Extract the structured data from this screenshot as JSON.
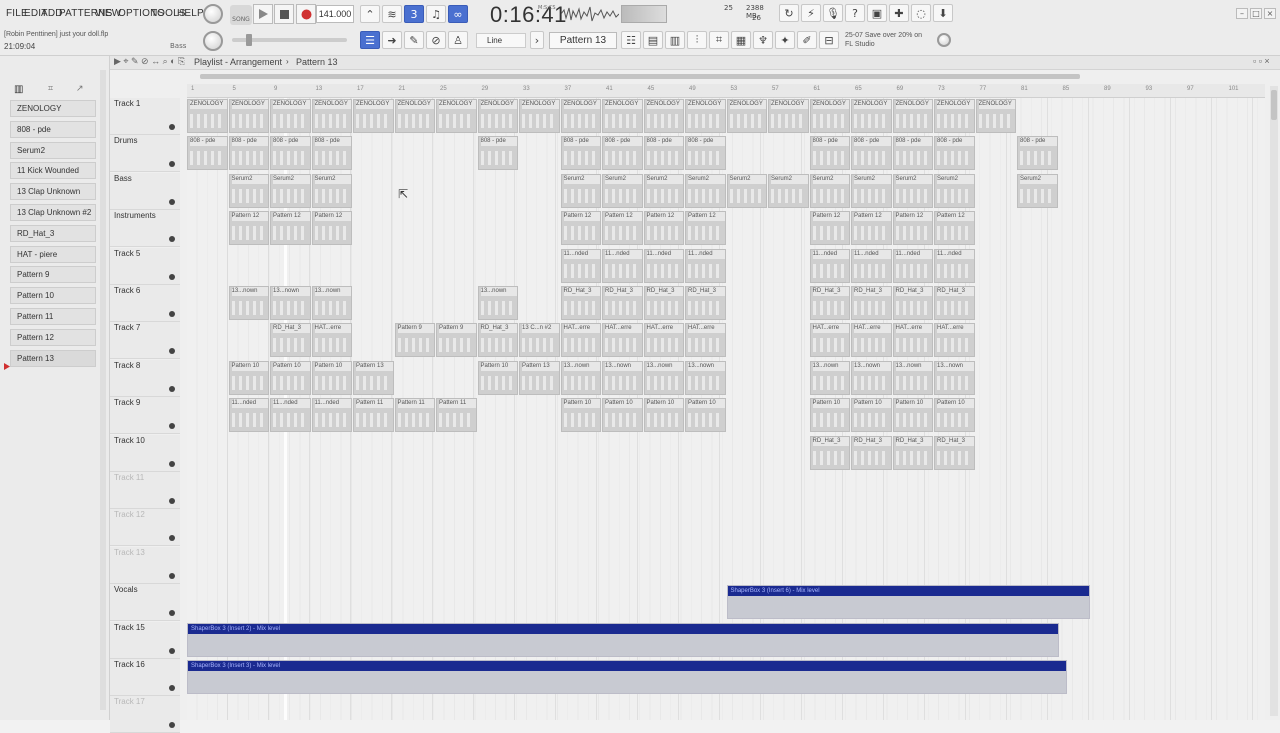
{
  "menu": [
    "FILE",
    "EDIT",
    "ADD",
    "PATTERNS",
    "VIEW",
    "OPTIONS",
    "TOOLS",
    "HELP"
  ],
  "hint_text": "[Robin Penttinen]  just your doll.flp",
  "hint_tag": "Bass",
  "clock": "21:09:04",
  "song_mode": "SONG",
  "tempo": "141.000",
  "time_display": "0:16:41",
  "time_units": "M:S:CS",
  "cpu": {
    "value": "25",
    "memory": "2388 MB",
    "polyphony": "26"
  },
  "pattern_selector": "Pattern 13",
  "snap": "Line",
  "news": {
    "line1": "25-07  Save over 20% on",
    "line2": "FL Studio"
  },
  "playlist": {
    "title": "Playlist - Arrangement",
    "pattern": "Pattern 13",
    "ruler": [
      "1",
      "5",
      "9",
      "13",
      "17",
      "21",
      "25",
      "29",
      "33",
      "37",
      "41",
      "45",
      "49",
      "53",
      "57",
      "61",
      "65",
      "69",
      "73",
      "77",
      "81",
      "85",
      "89",
      "93",
      "97",
      "101"
    ]
  },
  "channels": [
    {
      "label": "ZENOLOGY"
    },
    {
      "label": "808 - pde"
    },
    {
      "label": "Serum2"
    },
    {
      "label": "11 Kick Wounded"
    },
    {
      "label": "13 Clap Unknown"
    },
    {
      "label": "13 Clap Unknown #2"
    },
    {
      "label": "RD_Hat_3"
    },
    {
      "label": "HAT - piere"
    },
    {
      "label": "Pattern 9"
    },
    {
      "label": "Pattern 10"
    },
    {
      "label": "Pattern 11"
    },
    {
      "label": "Pattern 12"
    },
    {
      "label": "Pattern 13"
    }
  ],
  "tracks": [
    {
      "name": "Track 1"
    },
    {
      "name": "Drums"
    },
    {
      "name": "Bass"
    },
    {
      "name": "Instruments"
    },
    {
      "name": "Track 5"
    },
    {
      "name": "Track 6"
    },
    {
      "name": "Track 7"
    },
    {
      "name": "Track 8"
    },
    {
      "name": "Track 9"
    },
    {
      "name": "Track 10"
    },
    {
      "name": "Track 11"
    },
    {
      "name": "Track 12"
    },
    {
      "name": "Track 13"
    },
    {
      "name": "Vocals"
    },
    {
      "name": "Track 15"
    },
    {
      "name": "Track 16"
    },
    {
      "name": "Track 17"
    }
  ],
  "clip_labels": {
    "zen": "ZENOLOGY",
    "808": "808 - pde",
    "serum": "Serum2",
    "p12": "Pattern 12",
    "kick": "11...nded",
    "clap": "13...nown",
    "rdhat": "RD_Hat_3",
    "hat": "HAT...erre",
    "p9": "Pattern 9",
    "clap2": "13 C...n #2",
    "p10": "Pattern 10",
    "p13": "Pattern 13",
    "p11": "Pattern 11"
  },
  "automation": {
    "vocals": "ShaperBox 3 (Insert 6) - Mix level",
    "t15": "ShaperBox 3 (Insert 2) - Mix level",
    "t16": "ShaperBox 3 (Insert 3) - Mix level"
  },
  "colors": {
    "automation_head": "#1a2a90",
    "record": "#d03030",
    "accent": "#4a70d0"
  }
}
